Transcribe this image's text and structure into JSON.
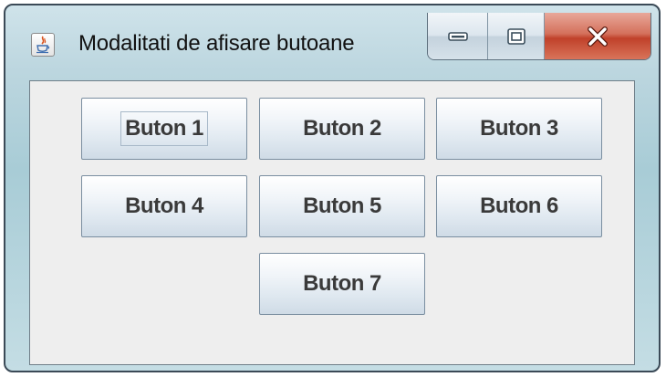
{
  "window": {
    "title": "Modalitati de afisare butoane",
    "icon": "java-cup-icon",
    "controls": {
      "minimize_icon": "minimize-icon",
      "maximize_icon": "maximize-icon",
      "close_label": "X"
    },
    "colors": {
      "close_button": "#c94a33",
      "frame": "#a8ccd6",
      "content_bg": "#eeeeee"
    }
  },
  "buttons": [
    {
      "label": "Buton 1",
      "focused": true
    },
    {
      "label": "Buton 2",
      "focused": false
    },
    {
      "label": "Buton 3",
      "focused": false
    },
    {
      "label": "Buton 4",
      "focused": false
    },
    {
      "label": "Buton 5",
      "focused": false
    },
    {
      "label": "Buton 6",
      "focused": false
    },
    {
      "label": "Buton 7",
      "focused": false
    }
  ]
}
